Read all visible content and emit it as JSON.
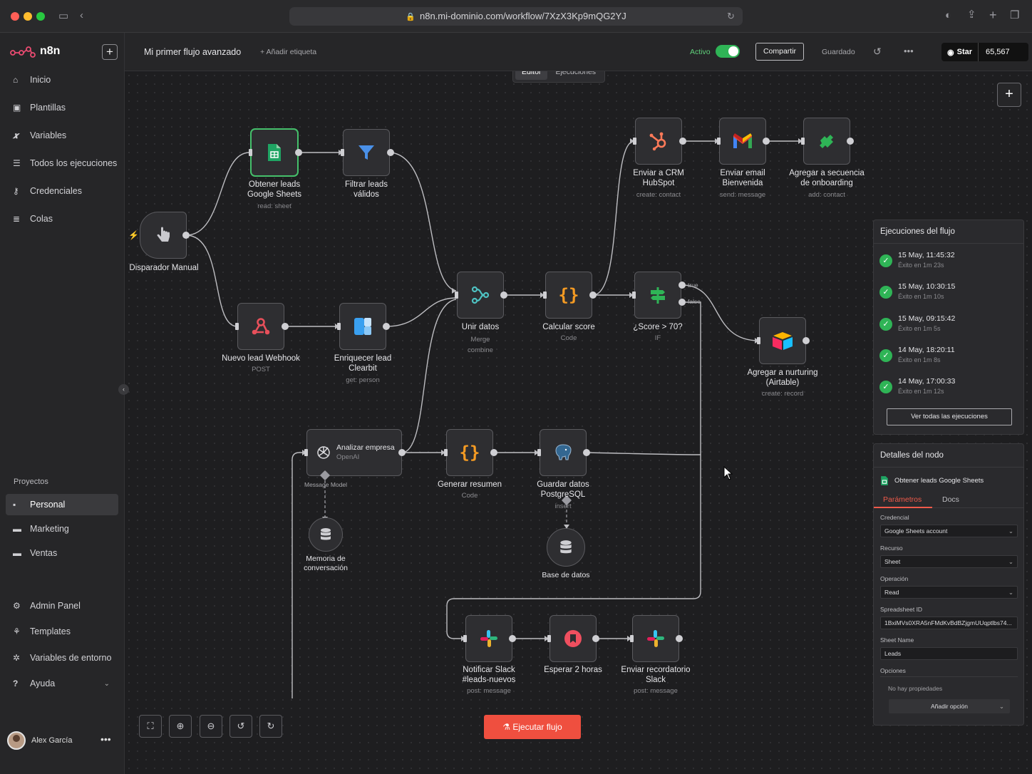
{
  "browser": {
    "url": "n8n.mi-dominio.com/workflow/7XzX3Kp9mQG2YJ"
  },
  "app": {
    "name": "n8n"
  },
  "sidebar": {
    "items": [
      {
        "label": "Inicio",
        "icon": "home-icon"
      },
      {
        "label": "Plantillas",
        "icon": "templates-icon"
      },
      {
        "label": "Variables",
        "icon": "variables-icon"
      },
      {
        "label": "Todos los ejecuciones",
        "icon": "list-icon"
      },
      {
        "label": "Credenciales",
        "icon": "key-icon"
      },
      {
        "label": "Colas",
        "icon": "database-icon"
      }
    ],
    "projects_label": "Proyectos",
    "projects": [
      {
        "label": "Personal",
        "active": true
      },
      {
        "label": "Marketing"
      },
      {
        "label": "Ventas"
      }
    ],
    "bottom": [
      {
        "label": "Admin Panel",
        "icon": "gear-icon"
      },
      {
        "label": "Templates",
        "icon": "sitemap-icon"
      },
      {
        "label": "Variables de entorno",
        "icon": "settings-icon"
      },
      {
        "label": "Ayuda",
        "icon": "help-icon"
      }
    ],
    "user": "Alex García"
  },
  "topbar": {
    "workflow_name": "Mi primer flujo avanzado",
    "add_tag": "+ Añadir etiqueta",
    "active_label": "Activo",
    "active": true,
    "share": "Compartir",
    "saved": "Guardado",
    "github_star": "Star",
    "github_count": "65,567"
  },
  "canvas_tabs": [
    "Editor",
    "Ejecuciones"
  ],
  "nodes": {
    "trigger": {
      "label": "Disparador Manual"
    },
    "sheets": {
      "label": "Obtener leads\nGoogle Sheets",
      "sub": "read: sheet"
    },
    "filter": {
      "label": "Filtrar leads\nválidos"
    },
    "webhook": {
      "label": "Nuevo lead Webhook",
      "sub": "POST"
    },
    "clearbit": {
      "label": "Enriquecer lead\nClearbit",
      "sub": "get: person"
    },
    "merge": {
      "label": "Unir datos",
      "sub": "Merge\ncombine"
    },
    "score": {
      "label": "Calcular score",
      "sub": "Code"
    },
    "if": {
      "label": "¿Score > 70?",
      "sub": "IF",
      "true_label": "true",
      "false_label": "false"
    },
    "hubspot": {
      "label": "Enviar a CRM\nHubSpot",
      "sub": "create: contact"
    },
    "gmail": {
      "label": "Enviar email\nBienvenida",
      "sub": "send: message"
    },
    "sequence": {
      "label": "Agregar a secuencia\nde onboarding",
      "sub": "add: contact"
    },
    "airtable": {
      "label": "Agregar a nurturing\n(Airtable)",
      "sub": "create: record"
    },
    "openai": {
      "label": "Analizar empresa",
      "sub": "OpenAI",
      "port": "Message Model"
    },
    "summary": {
      "label": "Generar resumen",
      "sub": "Code"
    },
    "postgres": {
      "label": "Guardar datos\nPostgreSQL",
      "sub": "insert"
    },
    "memory": {
      "label": "Memoria de\nconversación"
    },
    "db": {
      "label": "Base de datos"
    },
    "slack1": {
      "label": "Notificar Slack\n#leads-nuevos",
      "sub": "post: message"
    },
    "wait": {
      "label": "Esperar 2 horas"
    },
    "slack2": {
      "label": "Enviar recordatorio\nSlack",
      "sub": "post: message"
    }
  },
  "run_button": "Ejecutar flujo",
  "executions": {
    "title": "Ejecuciones del flujo",
    "items": [
      {
        "time": "15 May, 11:45:32",
        "status": "Éxito en 1m 23s"
      },
      {
        "time": "15 May, 10:30:15",
        "status": "Éxito en 1m 10s"
      },
      {
        "time": "15 May, 09:15:42",
        "status": "Éxito en 1m 5s"
      },
      {
        "time": "14 May, 18:20:11",
        "status": "Éxito en 1m 8s"
      },
      {
        "time": "14 May, 17:00:33",
        "status": "Éxito en 1m 12s"
      }
    ],
    "view_all": "Ver todas las ejecuciones"
  },
  "details": {
    "title": "Detalles del nodo",
    "node": "Obtener leads Google Sheets",
    "tabs": [
      "Parámetros",
      "Docs"
    ],
    "fields": [
      {
        "label": "Credencial",
        "value": "Google Sheets account",
        "select": true
      },
      {
        "label": "Recurso",
        "value": "Sheet",
        "select": true
      },
      {
        "label": "Operación",
        "value": "Read",
        "select": true
      },
      {
        "label": "Spreadsheet ID",
        "value": "1BxiMVs0XRA5nFMdKvBdBZjgmUUqptlbs74..."
      },
      {
        "label": "Sheet Name",
        "value": "Leads"
      }
    ],
    "options_label": "Opciones",
    "no_props": "No hay propiedades",
    "add_option": "Añadir opción"
  }
}
